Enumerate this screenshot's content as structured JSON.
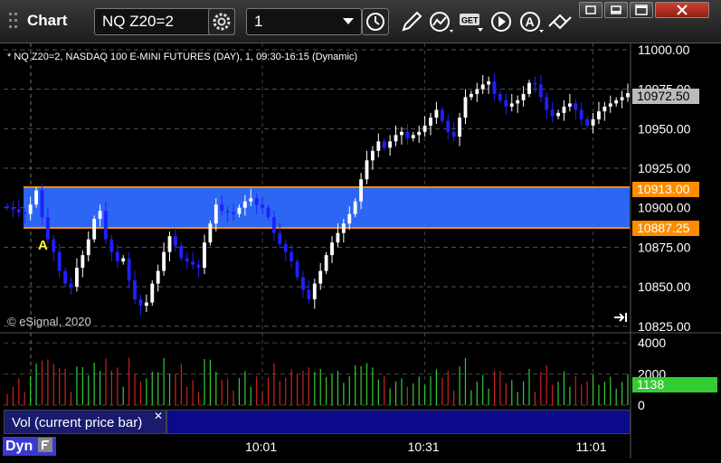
{
  "app": {
    "title": "Chart"
  },
  "toolbar": {
    "symbol": "NQ Z20=2",
    "interval": "1",
    "icons": [
      "gear-icon",
      "clock-icon",
      "pencil-icon",
      "line-study-icon",
      "get-icon",
      "play-icon",
      "alert-icon",
      "link-icon"
    ]
  },
  "chart": {
    "description": "* NQ Z20=2, NASDAQ 100 E-MINI FUTURES (DAY), 1, 09:30-16:15 (Dynamic)",
    "copyright": "© eSignal, 2020",
    "marker_label": "A",
    "last_price_label": "10972.50",
    "band_upper_label": "10913.00",
    "band_lower_label": "10887.25",
    "volume_last_label": "1138",
    "volume_study_label": "Vol (current price bar)",
    "footer_label": "Dyn",
    "colors": {
      "up": "#ffffff",
      "down": "#2020ff",
      "band": "#2f6bff",
      "band_line": "#ff8c00",
      "vol_up": "#33cc33",
      "vol_down": "#cc2222"
    }
  },
  "chart_data": {
    "type": "candlestick",
    "price_axis": {
      "ticks": [
        "11000.00",
        "10975.00",
        "10950.00",
        "10925.00",
        "10900.00",
        "10875.00",
        "10850.00",
        "10825.00"
      ],
      "range": [
        10822,
        11004
      ]
    },
    "time_axis": {
      "ticks": [
        "10:01",
        "10:31",
        "11:01"
      ]
    },
    "volume_axis": {
      "ticks": [
        "4000",
        "2000",
        "0"
      ],
      "range": [
        0,
        4300
      ]
    },
    "band": {
      "upper": 10913.0,
      "lower": 10887.25
    },
    "last_price": 10972.5,
    "last_volume": 1138,
    "closes": [
      10900,
      10899,
      10897,
      10896,
      10902,
      10911,
      10894,
      10880,
      10872,
      10860,
      10852,
      10850,
      10862,
      10870,
      10880,
      10893,
      10898,
      10880,
      10872,
      10866,
      10868,
      10854,
      10842,
      10838,
      10840,
      10852,
      10860,
      10872,
      10882,
      10876,
      10868,
      10866,
      10864,
      10862,
      10878,
      10890,
      10902,
      10898,
      10897,
      10896,
      10900,
      10904,
      10906,
      10902,
      10900,
      10894,
      10884,
      10877,
      10872,
      10866,
      10856,
      10848,
      10842,
      10852,
      10860,
      10870,
      10878,
      10884,
      10890,
      10896,
      10904,
      10918,
      10930,
      10936,
      10942,
      10938,
      10942,
      10946,
      10948,
      10944,
      10946,
      10948,
      10952,
      10957,
      10962,
      10955,
      10948,
      10945,
      10957,
      10970,
      10972,
      10975,
      10978,
      10980,
      10972,
      10968,
      10964,
      10966,
      10968,
      10972,
      10979,
      10978,
      10970,
      10962,
      10958,
      10960,
      10964,
      10966,
      10962,
      10956,
      10952,
      10956,
      10961,
      10964,
      10966,
      10968,
      10970,
      10972.5
    ]
  }
}
